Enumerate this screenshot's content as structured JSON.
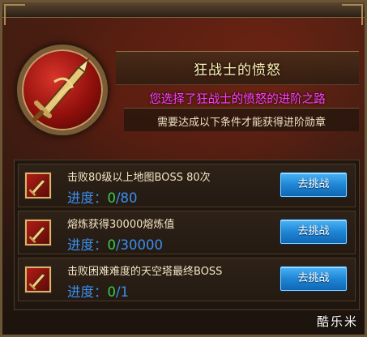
{
  "header": {
    "title": "狂战士的愤怒",
    "subtitle": "您选择了狂战士的愤怒的进阶之路",
    "info": "需要达成以下条件才能获得进阶勋章"
  },
  "emblem": {
    "icon": "sword-emblem-icon"
  },
  "tasks": [
    {
      "description": "击败80级以上地图BOSS 80次",
      "progress_label": "进度：",
      "done": "0",
      "total": "/80",
      "button_label": "去挑战"
    },
    {
      "description": "熔炼获得30000熔炼值",
      "progress_label": "进度：",
      "done": "0",
      "total": "/30000",
      "button_label": "去挑战"
    },
    {
      "description": "击败困难难度的天空塔最终BOSS",
      "progress_label": "进度：",
      "done": "0",
      "total": "/1",
      "button_label": "去挑战"
    }
  ],
  "watermark": "酷乐米",
  "colors": {
    "title": "#fff2b8",
    "subtitle": "#ff3cff",
    "progress_label": "#3a8ff0",
    "progress_done": "#33d14a",
    "button": "#1f86d6"
  }
}
